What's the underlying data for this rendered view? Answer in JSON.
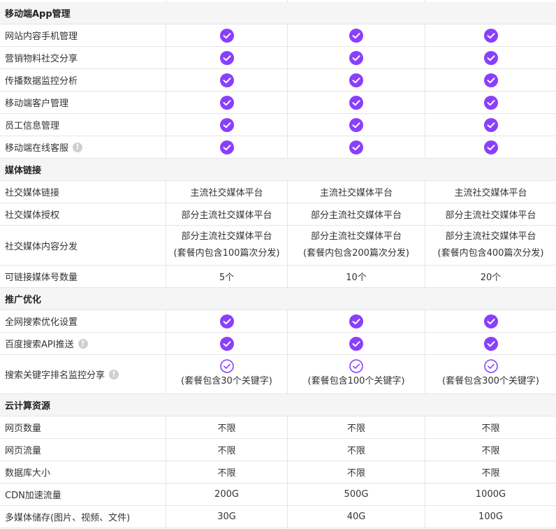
{
  "sections": {
    "mobile_app": {
      "title": "移动端App管理",
      "rows": [
        {
          "label": "网站内容手机管理"
        },
        {
          "label": "营销物料社交分享"
        },
        {
          "label": "传播数据监控分析"
        },
        {
          "label": "移动端客户管理"
        },
        {
          "label": "员工信息管理"
        },
        {
          "label": "移动端在线客服"
        }
      ]
    },
    "media_link": {
      "title": "媒体链接",
      "rows": [
        {
          "label": "社交媒体链接",
          "values": [
            "主流社交媒体平台",
            "主流社交媒体平台",
            "主流社交媒体平台"
          ]
        },
        {
          "label": "社交媒体授权",
          "values": [
            "部分主流社交媒体平台",
            "部分主流社交媒体平台",
            "部分主流社交媒体平台"
          ]
        },
        {
          "label": "社交媒体内容分发",
          "values": [
            "部分主流社交媒体平台",
            "部分主流社交媒体平台",
            "部分主流社交媒体平台"
          ],
          "notes": [
            "(套餐内包含100篇次分发)",
            "(套餐内包含200篇次分发)",
            "(套餐内包含400篇次分发)"
          ]
        },
        {
          "label": "可链接媒体号数量",
          "values": [
            "5个",
            "10个",
            "20个"
          ]
        }
      ]
    },
    "promotion": {
      "title": "推广优化",
      "rows": [
        {
          "label": "全网搜索优化设置"
        },
        {
          "label": "百度搜索API推送"
        },
        {
          "label": "搜索关键字排名监控分享",
          "notes": [
            "(套餐包含30个关键字)",
            "(套餐包含100个关键字)",
            "(套餐包含300个关键字)"
          ]
        }
      ]
    },
    "cloud": {
      "title": "云计算资源",
      "rows": [
        {
          "label": "网页数量",
          "values": [
            "不限",
            "不限",
            "不限"
          ]
        },
        {
          "label": "网页流量",
          "values": [
            "不限",
            "不限",
            "不限"
          ]
        },
        {
          "label": "数据库大小",
          "values": [
            "不限",
            "不限",
            "不限"
          ]
        },
        {
          "label": "CDN加速流量",
          "values": [
            "200G",
            "500G",
            "1000G"
          ]
        },
        {
          "label": "多媒体储存(图片、视频、文件)",
          "values": [
            "30G",
            "40G",
            "100G"
          ]
        }
      ]
    }
  },
  "info_icon_glyph": "!",
  "colors": {
    "accent": "#8a3ffc",
    "section_bg": "#f5f5f5",
    "border": "#e5e5e5",
    "info_icon": "#cfcfcf"
  },
  "icons": {
    "check_filled": "check-circle-filled-icon",
    "check_outline": "check-circle-outline-icon",
    "info": "info-icon"
  }
}
